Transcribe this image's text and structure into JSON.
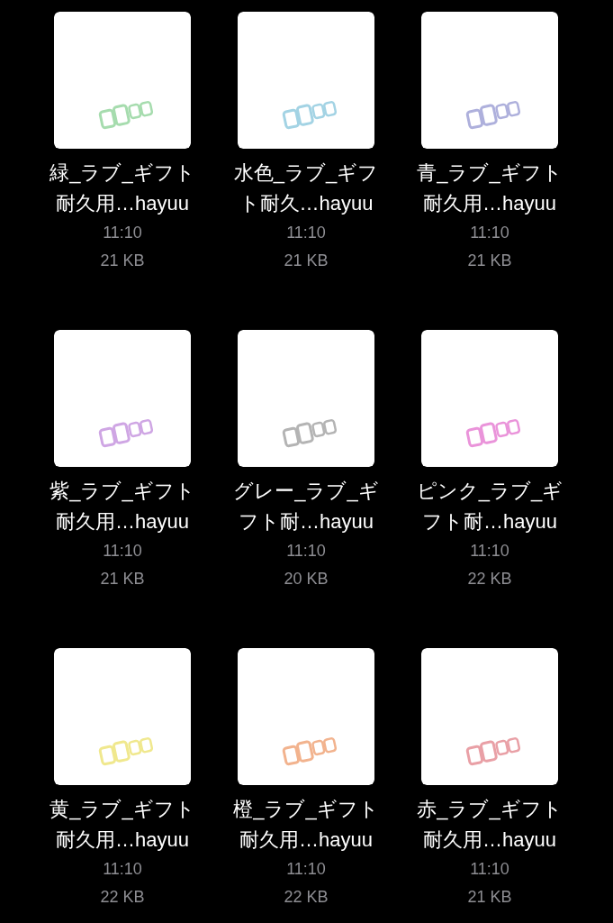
{
  "files": [
    {
      "name_lines": [
        "緑_ラブ_ギフト",
        "耐久用…hayuu"
      ],
      "time": "11:10",
      "size": "21 KB",
      "color": "#a6dcae"
    },
    {
      "name_lines": [
        "水色_ラブ_ギフ",
        "ト耐久…hayuu"
      ],
      "time": "11:10",
      "size": "21 KB",
      "color": "#a3d3e4"
    },
    {
      "name_lines": [
        "青_ラブ_ギフト",
        "耐久用…hayuu"
      ],
      "time": "11:10",
      "size": "21 KB",
      "color": "#aeb0dc"
    },
    {
      "name_lines": [
        "紫_ラブ_ギフト",
        "耐久用…hayuu"
      ],
      "time": "11:10",
      "size": "21 KB",
      "color": "#cfa6e4"
    },
    {
      "name_lines": [
        "グレー_ラブ_ギ",
        "フト耐…hayuu"
      ],
      "time": "11:10",
      "size": "20 KB",
      "color": "#b4b4b4"
    },
    {
      "name_lines": [
        "ピンク_ラブ_ギ",
        "フト耐…hayuu"
      ],
      "time": "11:10",
      "size": "22 KB",
      "color": "#ea94da"
    },
    {
      "name_lines": [
        "黄_ラブ_ギフト",
        "耐久用…hayuu"
      ],
      "time": "11:10",
      "size": "22 KB",
      "color": "#f0e88e"
    },
    {
      "name_lines": [
        "橙_ラブ_ギフト",
        "耐久用…hayuu"
      ],
      "time": "11:10",
      "size": "22 KB",
      "color": "#f2b38e"
    },
    {
      "name_lines": [
        "赤_ラブ_ギフト",
        "耐久用…hayuu"
      ],
      "time": "11:10",
      "size": "21 KB",
      "color": "#e9a0a6"
    }
  ]
}
